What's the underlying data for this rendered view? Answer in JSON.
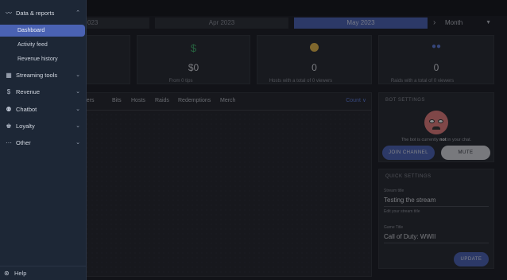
{
  "months": {
    "m1": "023",
    "m2": "Apr 2023",
    "m3": "May 2023"
  },
  "range": "Month",
  "stats": [
    {
      "icon": "dollar-icon",
      "glyph": "$",
      "value": "$0",
      "sub": "From 0 tips",
      "color": "#3fae6b"
    },
    {
      "icon": "user-circle-icon",
      "glyph": "●",
      "value": "0",
      "sub": "Hosts with a total of 0 viewers",
      "color": "#e0b44a"
    },
    {
      "icon": "users-icon",
      "glyph": "👥",
      "value": "0",
      "sub": "Raids with a total of 0 viewers",
      "color": "#5b79d6"
    }
  ],
  "tabs": [
    "ribers",
    "Bits",
    "Hosts",
    "Raids",
    "Redemptions",
    "Merch"
  ],
  "count_select": "Count",
  "bot": {
    "title": "BOT SETTINGS",
    "status_pre": "The bot is currently ",
    "status_bold": "not",
    "status_post": " in your chat.",
    "join": "JOIN CHANNEL",
    "mute": "MUTE"
  },
  "quick": {
    "title": "QUICK SETTINGS",
    "stream_title_label": "Stream title",
    "stream_title_value": "Testing the stream",
    "stream_title_help": "Edit your stream title",
    "game_label": "Game Title",
    "game_value": "Call of Duty: WWII",
    "update": "UPDATE"
  },
  "sidebar": {
    "data_reports": "Data & reports",
    "dashboard": "Dashboard",
    "activity_feed": "Activity feed",
    "revenue_history": "Revenue history",
    "streaming_tools": "Streaming tools",
    "revenue": "Revenue",
    "chatbot": "Chatbot",
    "loyalty": "Loyalty",
    "other": "Other",
    "help": "Help"
  },
  "accent": "#4a62b3"
}
